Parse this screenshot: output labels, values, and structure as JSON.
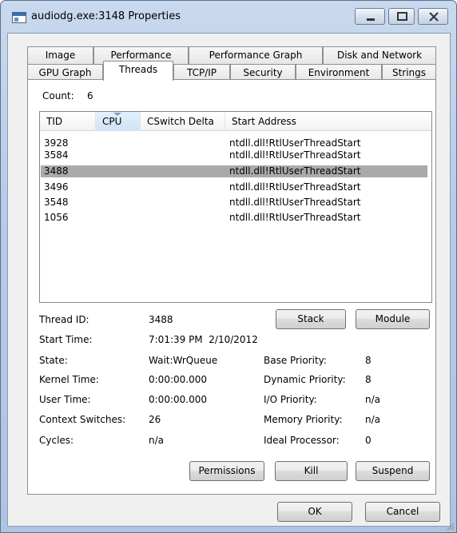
{
  "window": {
    "title": "audiodg.exe:3148 Properties"
  },
  "tabs_row1": [
    "Image",
    "Performance",
    "Performance Graph",
    "Disk and Network"
  ],
  "tabs_row2": [
    "GPU Graph",
    "Threads",
    "TCP/IP",
    "Security",
    "Environment",
    "Strings"
  ],
  "active_tab": "Threads",
  "count": {
    "label": "Count:",
    "value": "6"
  },
  "table": {
    "columns": [
      "TID",
      "CPU",
      "CSwitch Delta",
      "Start Address"
    ],
    "sorted_column": "CPU",
    "rows": [
      {
        "tid": "3928",
        "start": "ntdll.dll!RtlUserThreadStart"
      },
      {
        "tid": "3584",
        "start": "ntdll.dll!RtlUserThreadStart"
      },
      {
        "tid": "3488",
        "start": "ntdll.dll!RtlUserThreadStart",
        "selected": true
      },
      {
        "tid": "3496",
        "start": "ntdll.dll!RtlUserThreadStart"
      },
      {
        "tid": "3548",
        "start": "ntdll.dll!RtlUserThreadStart"
      },
      {
        "tid": "1056",
        "start": "ntdll.dll!RtlUserThreadStart"
      }
    ]
  },
  "details": {
    "thread_id_label": "Thread ID:",
    "thread_id": "3488",
    "start_time_label": "Start Time:",
    "start_time": "7:01:39 PM  2/10/2012",
    "state_label": "State:",
    "state": "Wait:WrQueue",
    "kernel_time_label": "Kernel Time:",
    "kernel_time": "0:00:00.000",
    "user_time_label": "User Time:",
    "user_time": "0:00:00.000",
    "context_switches_label": "Context Switches:",
    "context_switches": "26",
    "cycles_label": "Cycles:",
    "cycles": "n/a",
    "base_priority_label": "Base Priority:",
    "base_priority": "8",
    "dynamic_priority_label": "Dynamic Priority:",
    "dynamic_priority": "8",
    "io_priority_label": "I/O Priority:",
    "io_priority": "n/a",
    "memory_priority_label": "Memory Priority:",
    "memory_priority": "n/a",
    "ideal_processor_label": "Ideal Processor:",
    "ideal_processor": "0"
  },
  "buttons": {
    "stack": "Stack",
    "module": "Module",
    "permissions": "Permissions",
    "kill": "Kill",
    "suspend": "Suspend",
    "ok": "OK",
    "cancel": "Cancel"
  },
  "caption_icons": [
    "minimize-icon",
    "maximize-icon",
    "close-icon"
  ],
  "colors": {
    "selected_row": "#aaaaaa",
    "frame": "#b6cbe7"
  }
}
